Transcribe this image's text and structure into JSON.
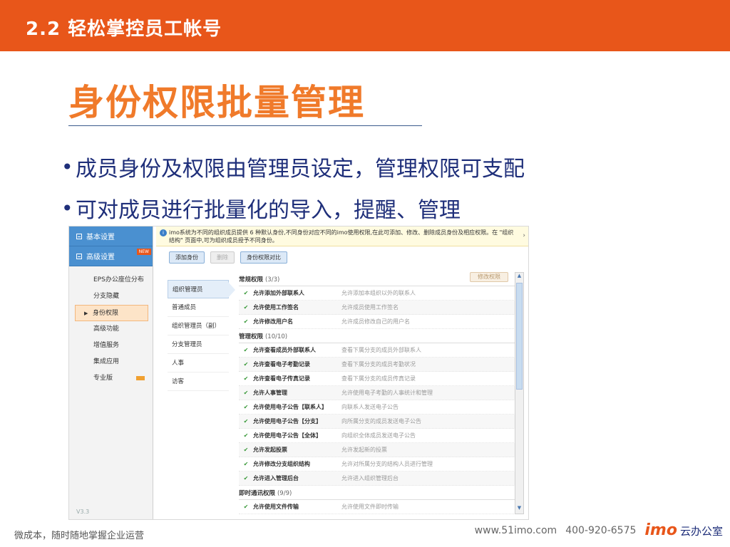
{
  "header": {
    "title": "2.2  轻松掌控员工帐号"
  },
  "main": {
    "title": "身份权限批量管理",
    "bullets": [
      "成员身份及权限由管理员设定，管理权限可支配",
      "可对成员进行批量化的导入，提醒、管理"
    ]
  },
  "screenshot": {
    "nav": {
      "basic_settings": "基本设置",
      "advanced_settings": "高级设置",
      "new_badge": "NEW",
      "items": [
        "EPS办公座位分布",
        "分支隐藏",
        "身份权限",
        "高级功能",
        "增值服务",
        "集成应用",
        "专业版"
      ],
      "active_index": 2,
      "version": "V3.3"
    },
    "info": {
      "text": "imo系统为不同的组织成员提供 6 种默认身份,不同身份对应不同的imo使用权限,在此可添加、修改、删除成员身份及相应权限。在 \"组织结构\" 页面中,可为组织成员授予不同身份。",
      "chevron": "›"
    },
    "toolbar": {
      "add": "添加身份",
      "delete": "删除",
      "compare": "身份权限对比"
    },
    "roles": [
      "组织管理员",
      "普通成员",
      "组织管理员（副）",
      "分支管理员",
      "人事",
      "访客"
    ],
    "edit_button": "修改权限",
    "groups": [
      {
        "title": "常规权限",
        "count": "(3/3)",
        "rows": [
          {
            "name": "允许添加外部联系人",
            "desc": "允许添加本组织以外的联系人"
          },
          {
            "name": "允许使用工作签名",
            "desc": "允许成员使用工作签名"
          },
          {
            "name": "允许修改用户名",
            "desc": "允许成员修改自己的用户名"
          }
        ]
      },
      {
        "title": "管理权限",
        "count": "(10/10)",
        "rows": [
          {
            "name": "允许查看成员外部联系人",
            "desc": "查看下属分支的成员外部联系人"
          },
          {
            "name": "允许查看电子考勤记录",
            "desc": "查看下属分支的成员考勤状况"
          },
          {
            "name": "允许查看电子传真记录",
            "desc": "查看下属分支的成员传真记录"
          },
          {
            "name": "允许人事管理",
            "desc": "允许使用电子考勤的人事统计和管理"
          },
          {
            "name": "允许使用电子公告【联系人】",
            "desc": "向联系人发送电子公告"
          },
          {
            "name": "允许使用电子公告【分支】",
            "desc": "向所属分支的成员发送电子公告"
          },
          {
            "name": "允许使用电子公告【全体】",
            "desc": "向组织全体成员发送电子公告"
          },
          {
            "name": "允许发起投票",
            "desc": "允许发起新的投票"
          },
          {
            "name": "允许修改分支组织结构",
            "desc": "允许对所属分支的结构人员进行管理"
          },
          {
            "name": "允许进入管理后台",
            "desc": "允许进入组织管理后台"
          }
        ]
      },
      {
        "title": "即时通讯权限",
        "count": "(9/9)",
        "rows": [
          {
            "name": "允许使用文件传输",
            "desc": "允许使用文件即时传输"
          }
        ]
      }
    ]
  },
  "footer": {
    "slogan": "微成本，随时随地掌握企业运营",
    "website": "www.51imo.com",
    "phone": "400-920-6575",
    "logo_brand": "imo",
    "logo_text": "云办公室"
  },
  "colors": {
    "brand_orange": "#e8561a",
    "title_orange": "#f07a2a",
    "bullet_blue": "#1f2f7a"
  }
}
